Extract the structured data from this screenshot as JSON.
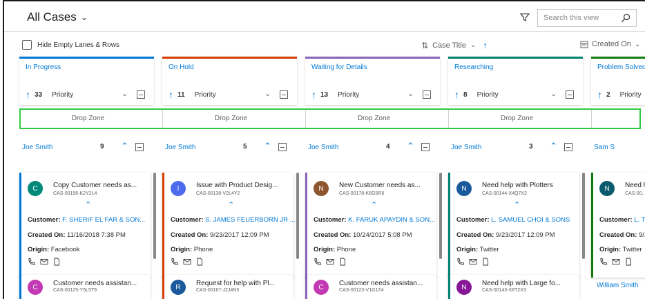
{
  "header": {
    "view_title": "All Cases",
    "search_placeholder": "Search this view"
  },
  "toolbar": {
    "hide_empty_label": "Hide Empty Lanes & Rows",
    "sort_field": "Case Title",
    "created_on_label": "Created On"
  },
  "colors": {
    "in_progress": "#0078d4",
    "on_hold": "#d83b01",
    "waiting": "#8764b8",
    "researching": "#008272",
    "problem": "#107c10",
    "dropzone_border": "#2ecc40"
  },
  "drop_zone_label": "Drop Zone",
  "lanes": [
    {
      "title": "In Progress",
      "count": "33",
      "sort": "Priority",
      "group": {
        "name": "Joe Smith",
        "count": "9"
      },
      "cards": [
        {
          "initial": "C",
          "avatar_color": "#00897b",
          "title": "Copy Customer needs as...",
          "id": "CAS-00196-K2Y2L4",
          "customer": "F. SHERIF EL FAR & SON...",
          "created_on": "11/16/2018 7:38 PM",
          "origin": "Facebook"
        },
        {
          "initial": "C",
          "avatar_color": "#c239b3",
          "title": "Customer needs assistan...",
          "id": "CAS-00125-Y5L5T9"
        }
      ]
    },
    {
      "title": "On Hold",
      "count": "11",
      "sort": "Priority",
      "group": {
        "name": "Joe Smith",
        "count": "5"
      },
      "cards": [
        {
          "initial": "I",
          "avatar_color": "#4f6bed",
          "title": "Issue with Product Desig...",
          "id": "CAS-00138-V2L4Y2",
          "customer": "S. JAMES FEUERBORN JR ...",
          "created_on": "9/23/2017 12:09 PM",
          "origin": "Phone"
        },
        {
          "initial": "R",
          "avatar_color": "#1a5a9c",
          "title": "Request for help with Pl...",
          "id": "CAS-00167-J2J4N5"
        }
      ]
    },
    {
      "title": "Waiting for Details",
      "count": "13",
      "sort": "Priority",
      "group": {
        "name": "Joe Smith",
        "count": "4"
      },
      "cards": [
        {
          "initial": "N",
          "avatar_color": "#8e562e",
          "title": "New Customer needs as...",
          "id": "CAS-00178-K6G5R6",
          "customer": "K. FARUK APAYDIN & SON...",
          "created_on": "10/24/2017 5:08 PM",
          "origin": "Phone"
        },
        {
          "initial": "C",
          "avatar_color": "#c239b3",
          "title": "Customer needs assistan...",
          "id": "CAS-00123-V1G1Z4"
        }
      ]
    },
    {
      "title": "Researching",
      "count": "8",
      "sort": "Priority",
      "group": {
        "name": "Joe Smith",
        "count": "3"
      },
      "cards": [
        {
          "initial": "N",
          "avatar_color": "#1a5a9c",
          "title": "Need help with Plotters",
          "id": "CAS-00144-X4Q7X2",
          "customer": "L. SAMUEL CHOI & SONS",
          "created_on": "9/23/2017 12:09 PM",
          "origin": "Twitter"
        },
        {
          "initial": "N",
          "avatar_color": "#881798",
          "title": "Need help with Large fo...",
          "id": "CAS-00143-X8T2X3"
        }
      ]
    },
    {
      "title": "Problem Solved",
      "count": "2",
      "sort": "Priority",
      "group": {
        "name": "Sam S",
        "count": ""
      },
      "cards": [
        {
          "initial": "N",
          "avatar_color": "#0b5a6e",
          "title": "Need h...",
          "id": "CAS-00...",
          "customer": "L. T...",
          "created_on": "9/2...",
          "origin": "Twitter"
        }
      ],
      "next_group": "William Smith"
    }
  ],
  "labels": {
    "customer": "Customer:",
    "created_on": "Created On:",
    "origin": "Origin:"
  }
}
